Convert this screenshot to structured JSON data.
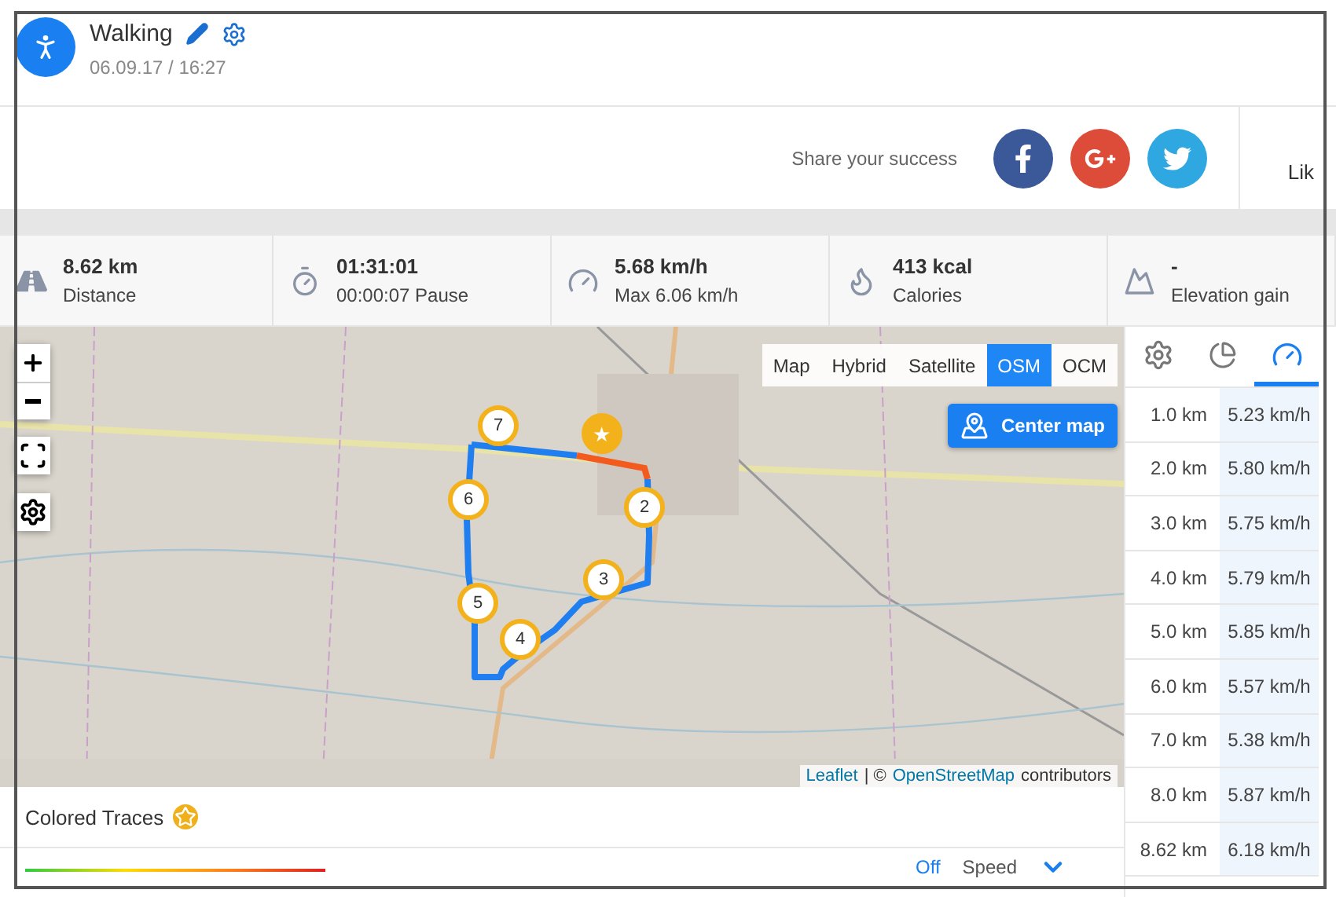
{
  "activity": {
    "title": "Walking",
    "date": "06.09.17 / 16:27"
  },
  "share": {
    "label": "Share your success",
    "networks": [
      {
        "kind": "facebook"
      },
      {
        "kind": "google"
      },
      {
        "kind": "twitter"
      }
    ],
    "side_text": "Lik"
  },
  "stats": [
    {
      "kind": "road",
      "value": "8.62 km",
      "label": "Distance"
    },
    {
      "kind": "timer",
      "value": "01:31:01",
      "label": "00:00:07 Pause"
    },
    {
      "kind": "gauge",
      "value": "5.68 km/h",
      "label": "Max 6.06 km/h"
    },
    {
      "kind": "flame",
      "value": "413 kcal",
      "label": "Calories"
    },
    {
      "kind": "mountain",
      "value": "-",
      "label": "Elevation gain"
    }
  ],
  "map": {
    "layers": [
      {
        "label": "Map",
        "selected": false
      },
      {
        "label": "Hybrid",
        "selected": false
      },
      {
        "label": "Satellite",
        "selected": false
      },
      {
        "label": "OSM",
        "selected": true
      },
      {
        "label": "OCM",
        "selected": false
      }
    ],
    "center_button": "Center map",
    "markers": [
      {
        "kind": "start",
        "label": "★"
      },
      {
        "kind": "number",
        "label": "2"
      },
      {
        "kind": "number",
        "label": "3"
      },
      {
        "kind": "number",
        "label": "4"
      },
      {
        "kind": "number",
        "label": "5"
      },
      {
        "kind": "number",
        "label": "6"
      },
      {
        "kind": "number",
        "label": "7"
      }
    ],
    "attribution": {
      "link1": "Leaflet",
      "separator": "| ©",
      "link2": "OpenStreetMap",
      "suffix": "contributors"
    }
  },
  "traces": {
    "title": "Colored Traces",
    "toggle": "Off",
    "metric": "Speed"
  },
  "splits": {
    "tabs": [
      {
        "kind": "settings",
        "selected": false
      },
      {
        "kind": "pie",
        "selected": false
      },
      {
        "kind": "gauge",
        "selected": true
      }
    ],
    "rows": [
      {
        "distance": "1.0 km",
        "speed": "5.23 km/h"
      },
      {
        "distance": "2.0 km",
        "speed": "5.80 km/h"
      },
      {
        "distance": "3.0 km",
        "speed": "5.75 km/h"
      },
      {
        "distance": "4.0 km",
        "speed": "5.79 km/h"
      },
      {
        "distance": "5.0 km",
        "speed": "5.85 km/h"
      },
      {
        "distance": "6.0 km",
        "speed": "5.57 km/h"
      },
      {
        "distance": "7.0 km",
        "speed": "5.38 km/h"
      },
      {
        "distance": "8.0 km",
        "speed": "5.87 km/h"
      },
      {
        "distance": "8.62 km",
        "speed": "6.18 km/h"
      }
    ]
  }
}
